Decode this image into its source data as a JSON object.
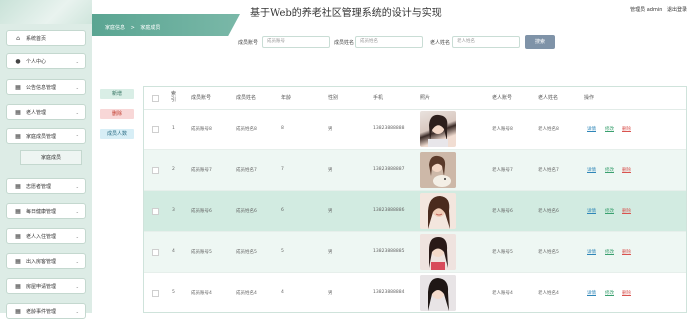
{
  "header": {
    "title": "基于Web的养老社区管理系统的设计与实现",
    "user_label": "管理员 admin",
    "logout": "退出登录"
  },
  "sidebar": {
    "items": [
      {
        "label": "系统首页",
        "icon": "home-icon",
        "glyph": "⌂"
      },
      {
        "label": "个人中心",
        "icon": "user-icon",
        "glyph": "👤"
      },
      {
        "label": "公告信息管理",
        "icon": "grid-icon",
        "glyph": "▦"
      },
      {
        "label": "老人管理",
        "icon": "grid-icon",
        "glyph": "▦"
      },
      {
        "label": "家庭成员管理",
        "icon": "grid-icon",
        "glyph": "▦"
      },
      {
        "label": "家庭成员",
        "icon": "",
        "glyph": ""
      },
      {
        "label": "志愿者管理",
        "icon": "grid-icon",
        "glyph": "▦"
      },
      {
        "label": "每日健康管理",
        "icon": "grid-icon",
        "glyph": "▦"
      },
      {
        "label": "老人入住管理",
        "icon": "grid-icon",
        "glyph": "▦"
      },
      {
        "label": "出入房客管理",
        "icon": "grid-icon",
        "glyph": "▦"
      },
      {
        "label": "房屋申请管理",
        "icon": "grid-icon",
        "glyph": "▦"
      },
      {
        "label": "老龄事件管理",
        "icon": "grid-icon",
        "glyph": "▦"
      }
    ]
  },
  "breadcrumb": [
    "家庭信息",
    "家庭成员"
  ],
  "search": {
    "fields": [
      {
        "label": "成员账号",
        "placeholder": "成员账号"
      },
      {
        "label": "成员姓名",
        "placeholder": "成员姓名"
      },
      {
        "label": "老人姓名",
        "placeholder": "老人姓名"
      }
    ],
    "button": "搜索"
  },
  "actions": {
    "add": "新增",
    "delete": "删除",
    "stats": "成员人数"
  },
  "table": {
    "headers": [
      "索引",
      "成员账号",
      "成员姓名",
      "年龄",
      "性别",
      "手机",
      "照片",
      "老人账号",
      "老人姓名",
      "操作"
    ],
    "rows": [
      {
        "index": "1",
        "account": "成员账号8",
        "name": "成员姓名8",
        "age": "8",
        "gender": "男",
        "phone": "13823888888",
        "elder_account": "老人账号8",
        "elder_name": "老人姓名8"
      },
      {
        "index": "2",
        "account": "成员账号7",
        "name": "成员姓名7",
        "age": "7",
        "gender": "男",
        "phone": "13823888887",
        "elder_account": "老人账号7",
        "elder_name": "老人姓名7"
      },
      {
        "index": "3",
        "account": "成员账号6",
        "name": "成员姓名6",
        "age": "6",
        "gender": "男",
        "phone": "13823888886",
        "elder_account": "老人账号6",
        "elder_name": "老人姓名6"
      },
      {
        "index": "4",
        "account": "成员账号5",
        "name": "成员姓名5",
        "age": "5",
        "gender": "男",
        "phone": "13823888885",
        "elder_account": "老人账号5",
        "elder_name": "老人姓名5"
      },
      {
        "index": "5",
        "account": "成员账号4",
        "name": "成员姓名4",
        "age": "4",
        "gender": "男",
        "phone": "13823888884",
        "elder_account": "老人账号4",
        "elder_name": "老人姓名4"
      }
    ],
    "ops": {
      "detail": "详情",
      "edit": "修改",
      "delete": "删除"
    }
  },
  "colors": {
    "accent": "#5aa592",
    "sidebar_bg": "#ddece6",
    "row_alt": "#eef7f3",
    "search_button": "#7f93a8"
  }
}
